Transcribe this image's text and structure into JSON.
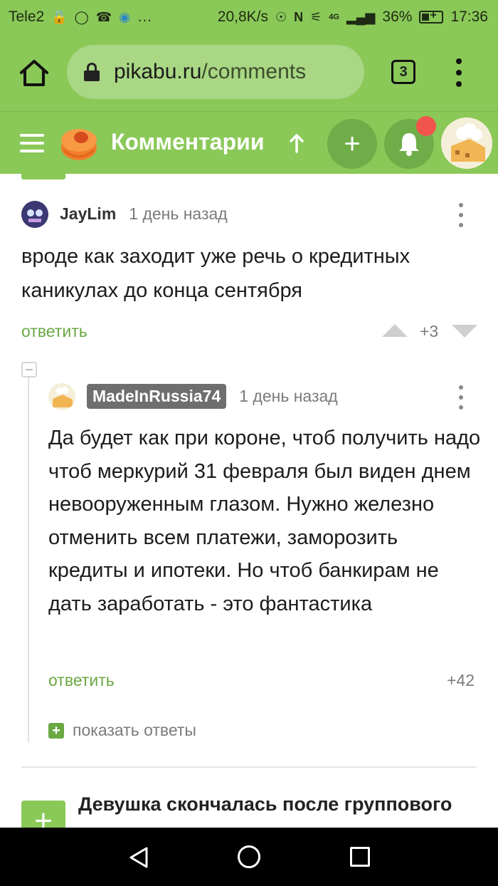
{
  "status_bar": {
    "carrier": "Tele2",
    "extra_icons": "…",
    "net_speed": "20,8K/s",
    "signal_label": "4G",
    "battery": "36%",
    "time": "17:36"
  },
  "browser": {
    "url_domain": "pikabu.ru",
    "url_path": "/comments",
    "tab_count": "3"
  },
  "header": {
    "title": "Комментарии",
    "plus_label": "+"
  },
  "comments": [
    {
      "author": "JayLim",
      "time": "1 день назад",
      "text": "вроде как заходит уже речь о кредитных каникулах до конца сентября",
      "reply_label": "ответить",
      "rating": "+3"
    },
    {
      "author": "MadeInRussia74",
      "time": "1 день назад",
      "text": "Да будет как при короне, чтоб получить надо чтоб меркурий 31 февраля был виден днем невооруженным глазом. Нужно железно отменить всем платежи, заморозить кредиты и ипотеки. Но чтоб банкирам не дать заработать - это фантастика",
      "reply_label": "ответить",
      "rating": "+42",
      "show_replies_label": "показать ответы"
    }
  ],
  "next_post": {
    "plus_label": "+",
    "title": "Девушка скончалась после группового"
  },
  "colors": {
    "brand_green": "#8ac858",
    "link_green": "#69a843",
    "notification_red": "#f0544d"
  }
}
